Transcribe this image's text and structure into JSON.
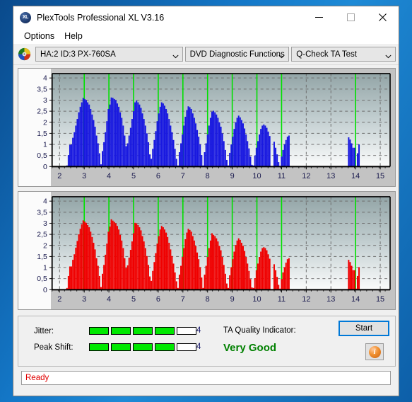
{
  "window": {
    "title": "PlexTools Professional XL V3.16",
    "icon": "app-xl-icon",
    "minimize": "minimize-icon",
    "maximize": "maximize-icon",
    "close": "close-icon"
  },
  "menu": {
    "items": [
      {
        "label": "Options"
      },
      {
        "label": "Help"
      }
    ]
  },
  "toolbar": {
    "disc_icon": "disc-icon",
    "drive_select": "HA:2 ID:3  PX-760SA",
    "function_select": "DVD Diagnostic Functions",
    "test_select": "Q-Check TA Test"
  },
  "indicators": {
    "jitter_label": "Jitter:",
    "jitter_value": "4",
    "jitter_filled": 4,
    "jitter_total": 5,
    "peak_shift_label": "Peak Shift:",
    "peak_shift_value": "4",
    "peak_shift_filled": 4,
    "peak_shift_total": 5,
    "ta_quality_label": "TA Quality Indicator:",
    "ta_quality_value": "Very Good",
    "ta_quality_color": "#008000",
    "start_button": "Start",
    "info_button": "info-icon",
    "info_glyph": "i"
  },
  "status": {
    "text": "Ready",
    "color": "#e00000"
  },
  "chart_data": [
    {
      "id": "jitter-chart",
      "type": "bar",
      "title": "",
      "xlabel": "",
      "ylabel": "",
      "series_color": "#1818e0",
      "marker_color": "#00e000",
      "xlim": [
        1.7,
        15.4
      ],
      "ylim": [
        0,
        4.2
      ],
      "xticks": [
        2,
        3,
        4,
        5,
        6,
        7,
        8,
        9,
        10,
        11,
        12,
        13,
        14,
        15
      ],
      "yticks": [
        0,
        0.5,
        1,
        1.5,
        2,
        2.5,
        3,
        3.5,
        4
      ],
      "ytick_labels": [
        "0",
        "0,5",
        "1",
        "1,5",
        "2",
        "2,5",
        "3",
        "3,5",
        "4"
      ],
      "grid": true,
      "markers": [
        3,
        4,
        5,
        6,
        7,
        8,
        9,
        10,
        11,
        14
      ],
      "x": [
        2.3,
        2.36,
        2.42,
        2.48,
        2.54,
        2.6,
        2.66,
        2.72,
        2.78,
        2.84,
        2.9,
        2.96,
        3.02,
        3.08,
        3.14,
        3.2,
        3.26,
        3.32,
        3.38,
        3.44,
        3.5,
        3.56,
        3.62,
        3.68,
        3.74,
        3.8,
        3.86,
        3.92,
        3.98,
        4.04,
        4.1,
        4.16,
        4.22,
        4.28,
        4.34,
        4.4,
        4.46,
        4.52,
        4.58,
        4.64,
        4.7,
        4.76,
        4.82,
        4.88,
        4.94,
        5.0,
        5.06,
        5.12,
        5.18,
        5.24,
        5.3,
        5.36,
        5.42,
        5.48,
        5.54,
        5.6,
        5.66,
        5.72,
        5.78,
        5.84,
        5.9,
        5.96,
        6.02,
        6.08,
        6.14,
        6.2,
        6.26,
        6.32,
        6.38,
        6.44,
        6.5,
        6.56,
        6.62,
        6.68,
        6.74,
        6.8,
        6.86,
        6.92,
        6.98,
        7.04,
        7.1,
        7.16,
        7.22,
        7.28,
        7.34,
        7.4,
        7.46,
        7.52,
        7.58,
        7.64,
        7.7,
        7.76,
        7.82,
        7.88,
        7.94,
        8.0,
        8.06,
        8.12,
        8.18,
        8.24,
        8.3,
        8.36,
        8.42,
        8.48,
        8.54,
        8.6,
        8.66,
        8.72,
        8.78,
        8.84,
        8.9,
        8.96,
        9.02,
        9.08,
        9.14,
        9.2,
        9.26,
        9.32,
        9.38,
        9.44,
        9.5,
        9.56,
        9.62,
        9.68,
        9.74,
        9.8,
        9.86,
        9.92,
        9.98,
        10.04,
        10.1,
        10.16,
        10.22,
        10.28,
        10.34,
        10.4,
        10.46,
        10.52,
        10.7,
        10.76,
        10.82,
        10.88,
        10.94,
        11.0,
        11.06,
        11.12,
        11.18,
        11.24,
        11.3,
        13.72,
        13.78,
        13.84,
        13.9,
        13.96,
        14.02,
        14.08,
        14.14
      ],
      "values": [
        0.05,
        0.52,
        0.98,
        1.0,
        1.3,
        1.55,
        1.85,
        2.15,
        2.45,
        2.7,
        2.9,
        3.1,
        3.05,
        3.0,
        2.9,
        2.8,
        2.6,
        2.35,
        2.1,
        1.8,
        1.4,
        1.05,
        0.6,
        0.1,
        0.7,
        1.1,
        1.55,
        2.05,
        2.6,
        2.8,
        3.12,
        3.1,
        3.05,
        3.0,
        2.85,
        2.7,
        2.45,
        2.2,
        1.85,
        1.4,
        0.92,
        1.05,
        1.4,
        1.75,
        2.15,
        2.5,
        2.9,
        2.98,
        2.9,
        2.8,
        2.65,
        2.4,
        2.15,
        1.85,
        1.5,
        1.1,
        0.55,
        0.35,
        0.8,
        1.2,
        1.6,
        2.05,
        2.4,
        2.7,
        2.9,
        2.85,
        2.75,
        2.6,
        2.4,
        2.15,
        1.85,
        1.55,
        1.2,
        0.8,
        0.35,
        0.05,
        0.65,
        1.05,
        1.45,
        1.85,
        2.25,
        2.55,
        2.72,
        2.68,
        2.6,
        2.4,
        2.2,
        1.95,
        1.65,
        1.35,
        1.0,
        0.52,
        0.05,
        0.65,
        1.05,
        1.45,
        1.85,
        2.2,
        2.48,
        2.52,
        2.45,
        2.35,
        2.2,
        2.0,
        1.8,
        1.5,
        1.15,
        0.75,
        0.3,
        0.05,
        0.62,
        1.0,
        1.35,
        1.7,
        2.0,
        2.2,
        2.3,
        2.22,
        2.1,
        1.95,
        1.72,
        1.45,
        1.15,
        0.82,
        0.45,
        0.08,
        0.05,
        0.5,
        0.85,
        1.15,
        1.45,
        1.7,
        1.85,
        1.9,
        1.85,
        1.75,
        1.58,
        1.38,
        1.12,
        0.85,
        0.55,
        0.2,
        0.03,
        0.45,
        0.75,
        1.0,
        1.2,
        1.35,
        1.4,
        1.32,
        1.22,
        1.05,
        0.85,
        0.85,
        0.02,
        0.6,
        1.0,
        1.25,
        1.45,
        1.62,
        1.3,
        0.7,
        0.05
      ]
    },
    {
      "id": "peak-shift-chart",
      "type": "bar",
      "title": "",
      "xlabel": "",
      "ylabel": "",
      "series_color": "#f00000",
      "marker_color": "#00e000",
      "xlim": [
        1.7,
        15.4
      ],
      "ylim": [
        0,
        4.2
      ],
      "xticks": [
        2,
        3,
        4,
        5,
        6,
        7,
        8,
        9,
        10,
        11,
        12,
        13,
        14,
        15
      ],
      "yticks": [
        0,
        0.5,
        1,
        1.5,
        2,
        2.5,
        3,
        3.5,
        4
      ],
      "ytick_labels": [
        "0",
        "0,5",
        "1",
        "1,5",
        "2",
        "2,5",
        "3",
        "3,5",
        "4"
      ],
      "grid": true,
      "markers": [
        3,
        4,
        5,
        6,
        7,
        8,
        9,
        10,
        11,
        14
      ],
      "x": [
        2.3,
        2.36,
        2.42,
        2.48,
        2.54,
        2.6,
        2.66,
        2.72,
        2.78,
        2.84,
        2.9,
        2.96,
        3.02,
        3.08,
        3.14,
        3.2,
        3.26,
        3.32,
        3.38,
        3.44,
        3.5,
        3.56,
        3.62,
        3.68,
        3.74,
        3.8,
        3.86,
        3.92,
        3.98,
        4.04,
        4.1,
        4.16,
        4.22,
        4.28,
        4.34,
        4.4,
        4.46,
        4.52,
        4.58,
        4.64,
        4.7,
        4.76,
        4.82,
        4.88,
        4.94,
        5.0,
        5.06,
        5.12,
        5.18,
        5.24,
        5.3,
        5.36,
        5.42,
        5.48,
        5.54,
        5.6,
        5.66,
        5.72,
        5.78,
        5.84,
        5.9,
        5.96,
        6.02,
        6.08,
        6.14,
        6.2,
        6.26,
        6.32,
        6.38,
        6.44,
        6.5,
        6.56,
        6.62,
        6.68,
        6.74,
        6.8,
        6.86,
        6.92,
        6.98,
        7.04,
        7.1,
        7.16,
        7.22,
        7.28,
        7.34,
        7.4,
        7.46,
        7.52,
        7.58,
        7.64,
        7.7,
        7.76,
        7.82,
        7.88,
        7.94,
        8.0,
        8.06,
        8.12,
        8.18,
        8.24,
        8.3,
        8.36,
        8.42,
        8.48,
        8.54,
        8.6,
        8.66,
        8.72,
        8.78,
        8.84,
        8.9,
        8.96,
        9.02,
        9.08,
        9.14,
        9.2,
        9.26,
        9.32,
        9.38,
        9.44,
        9.5,
        9.56,
        9.62,
        9.68,
        9.74,
        9.8,
        9.86,
        9.92,
        9.98,
        10.04,
        10.1,
        10.16,
        10.22,
        10.28,
        10.34,
        10.4,
        10.46,
        10.52,
        10.7,
        10.76,
        10.82,
        10.88,
        10.94,
        11.0,
        11.06,
        11.12,
        11.18,
        11.24,
        11.3,
        13.72,
        13.78,
        13.84,
        13.9,
        13.96,
        14.02,
        14.08,
        14.14
      ],
      "values": [
        0.08,
        0.62,
        1.05,
        1.05,
        1.35,
        1.6,
        1.9,
        2.2,
        2.5,
        2.75,
        2.95,
        3.13,
        3.08,
        3.02,
        2.92,
        2.82,
        2.62,
        2.38,
        2.12,
        1.82,
        1.42,
        1.08,
        0.62,
        0.12,
        0.72,
        1.12,
        1.58,
        2.08,
        2.62,
        2.85,
        3.18,
        3.12,
        3.06,
        3.0,
        2.88,
        2.72,
        2.48,
        2.22,
        1.88,
        1.42,
        0.98,
        1.1,
        1.45,
        1.8,
        2.18,
        2.55,
        3.02,
        3.0,
        2.92,
        2.82,
        2.68,
        2.42,
        2.18,
        1.88,
        1.52,
        1.12,
        0.6,
        0.4,
        0.85,
        1.25,
        1.65,
        2.08,
        2.42,
        2.72,
        2.88,
        2.82,
        2.72,
        2.58,
        2.38,
        2.12,
        1.82,
        1.52,
        1.18,
        0.78,
        0.38,
        0.08,
        0.68,
        1.08,
        1.48,
        1.88,
        2.28,
        2.58,
        2.75,
        2.7,
        2.62,
        2.42,
        2.22,
        1.98,
        1.68,
        1.38,
        1.02,
        0.55,
        0.08,
        0.68,
        1.08,
        1.48,
        1.88,
        2.22,
        2.55,
        2.48,
        2.42,
        2.32,
        2.18,
        1.98,
        1.78,
        1.48,
        1.12,
        0.72,
        0.28,
        0.08,
        0.65,
        1.02,
        1.38,
        1.72,
        2.02,
        2.22,
        2.32,
        2.25,
        2.12,
        1.98,
        1.75,
        1.48,
        1.18,
        0.85,
        0.48,
        0.1,
        0.08,
        0.52,
        0.88,
        1.18,
        1.48,
        1.72,
        1.88,
        1.92,
        1.88,
        1.78,
        1.6,
        1.4,
        1.15,
        0.88,
        0.58,
        0.22,
        0.05,
        0.48,
        0.78,
        1.02,
        1.22,
        1.38,
        1.42,
        1.35,
        1.25,
        1.08,
        0.88,
        0.88,
        0.05,
        0.62,
        1.02,
        1.28,
        1.48,
        1.68,
        1.32,
        0.72,
        0.08
      ]
    }
  ]
}
